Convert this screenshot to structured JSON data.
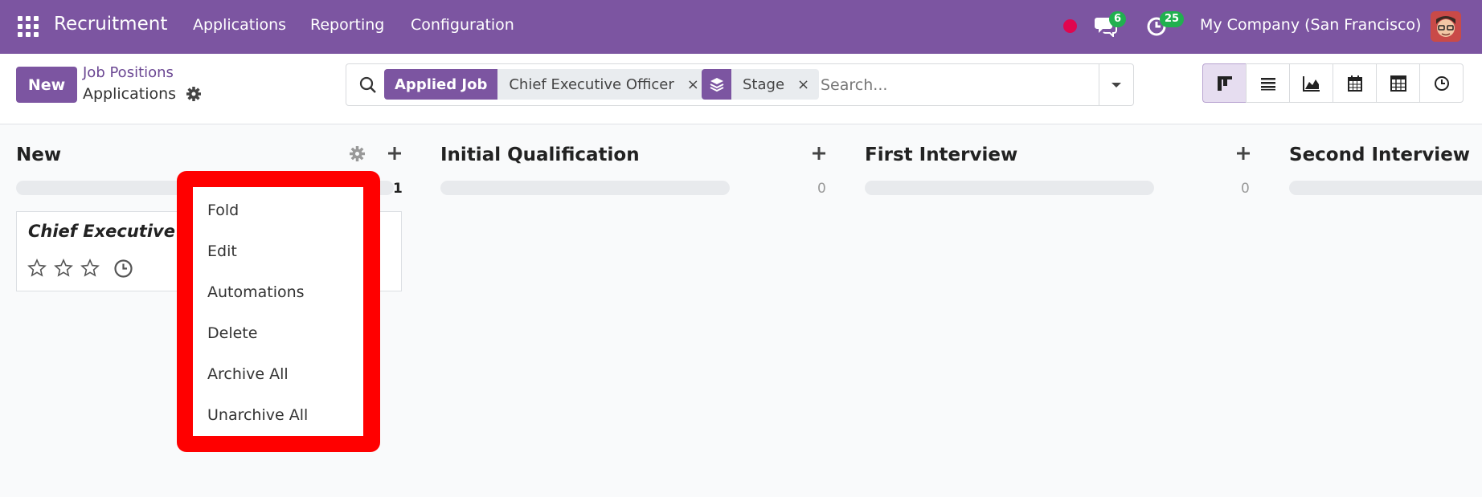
{
  "navbar": {
    "app_name": "Recruitment",
    "menus": [
      "Applications",
      "Reporting",
      "Configuration"
    ],
    "chat_count": "6",
    "activity_count": "25",
    "company": "My Company (San Francisco)"
  },
  "control": {
    "new_label": "New",
    "breadcrumb_parent": "Job Positions",
    "breadcrumb_current": "Applications"
  },
  "search": {
    "facet_job_label": "Applied Job",
    "facet_job_value": "Chief Executive Officer",
    "facet_stage_value": "Stage",
    "close_glyph": "×",
    "placeholder": "Search..."
  },
  "kanban": {
    "columns": [
      {
        "title": "New",
        "count": "1"
      },
      {
        "title": "Initial Qualification",
        "count": "0"
      },
      {
        "title": "First Interview",
        "count": "0"
      },
      {
        "title": "Second Interview",
        "count": ""
      }
    ],
    "card": {
      "title": "Chief Executive Officer",
      "rating": 0
    }
  },
  "dropdown": {
    "items": [
      "Fold",
      "Edit",
      "Automations",
      "Delete",
      "Archive All",
      "Unarchive All"
    ]
  },
  "colors": {
    "brand": "#7c55a1",
    "highlight": "#ff0000",
    "badge": "#21b04f"
  }
}
